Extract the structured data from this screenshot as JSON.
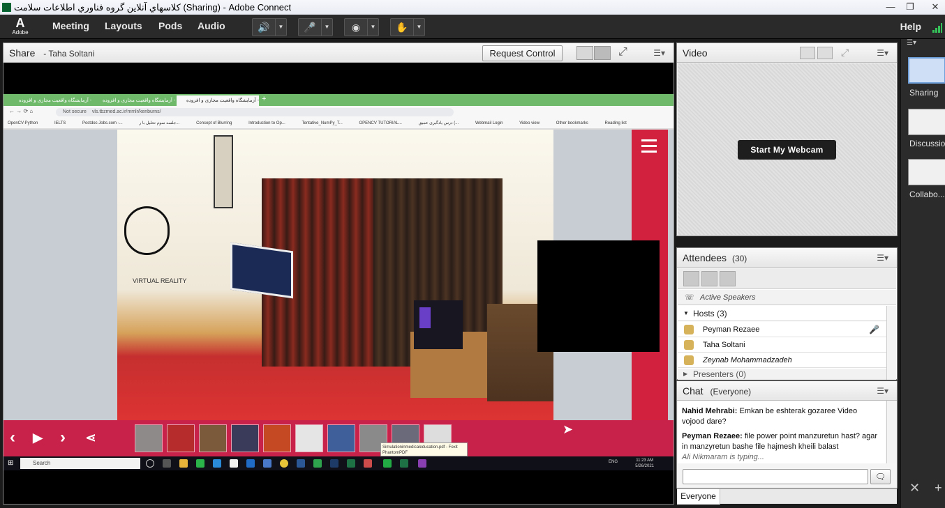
{
  "window": {
    "title": "كلاسهاي آنلاين گروه فناوري اطلاعات سلامت (Sharing) - Adobe Connect",
    "controls": [
      "—",
      "❐",
      "✕"
    ]
  },
  "menubar": {
    "logo_text": "Adobe",
    "items": [
      "Meeting",
      "Layouts",
      "Pods",
      "Audio"
    ],
    "help": "Help",
    "speaker_color": "#35c05a"
  },
  "share_pod": {
    "title": "Share",
    "presenter": "- Taha Soltani",
    "request_control": "Request Control",
    "browser": {
      "tabs": [
        "آزمایشگاه واقعیت مجازی و افزوده - ...",
        "آزمایشگاه واقعیت مجازی و افزوده - ...",
        "آزمایشگاه واقعیت مجازی و افزوده - ..."
      ],
      "not_secure": "Not secure",
      "url": "vls.tbzmed.ac.ir/mmlr/kenburns/",
      "bookmarks": [
        "OpenCV-Python",
        "IELTS",
        "Postdoc Jobs.com -...",
        "جلسه سوم تحلیل با ر...",
        "Concept of Blurring",
        "Introduction to Op...",
        "Tentative_NumPy_T...",
        "OPENCV TUTORIAL...",
        "درس یادگیری عمیق (...",
        "Webmail Login",
        "Video view",
        "Other bookmarks",
        "Reading list"
      ],
      "vr_label": "VIRTUAL REALITY",
      "tooltip_line1": "Simulationinmedicaleducation.pdf - Foxit",
      "tooltip_line2": "PhantomPDF",
      "taskbar_search": "Search",
      "clock_time": "11:23 AM",
      "clock_date": "5/26/2021",
      "tray_lang": "ENG"
    }
  },
  "video_pod": {
    "title": "Video",
    "start_webcam": "Start My Webcam"
  },
  "attendees_pod": {
    "title": "Attendees",
    "count": "(30)",
    "active_speakers": "Active Speakers",
    "hosts_label": "Hosts (3)",
    "hosts": [
      "Peyman Rezaee",
      "Taha Soltani",
      "Zeynab Mohammadzadeh"
    ],
    "presenters_label": "Presenters (0)"
  },
  "chat_pod": {
    "title": "Chat",
    "scope": "(Everyone)",
    "messages": [
      {
        "sender": "Nahid Mehrabi:",
        "text": "Emkan be eshterak gozaree Video vojood dare?"
      },
      {
        "sender": "Peyman Rezaee:",
        "text": "file power point manzuretun hast? agar in manzyretun bashe file hajmesh kheili balast"
      }
    ],
    "typing": "Ali Nikmaram is typing...",
    "tab_everyone": "Everyone"
  },
  "layouts_rail": {
    "items": [
      "Sharing",
      "Discussion",
      "Collabo..."
    ]
  }
}
